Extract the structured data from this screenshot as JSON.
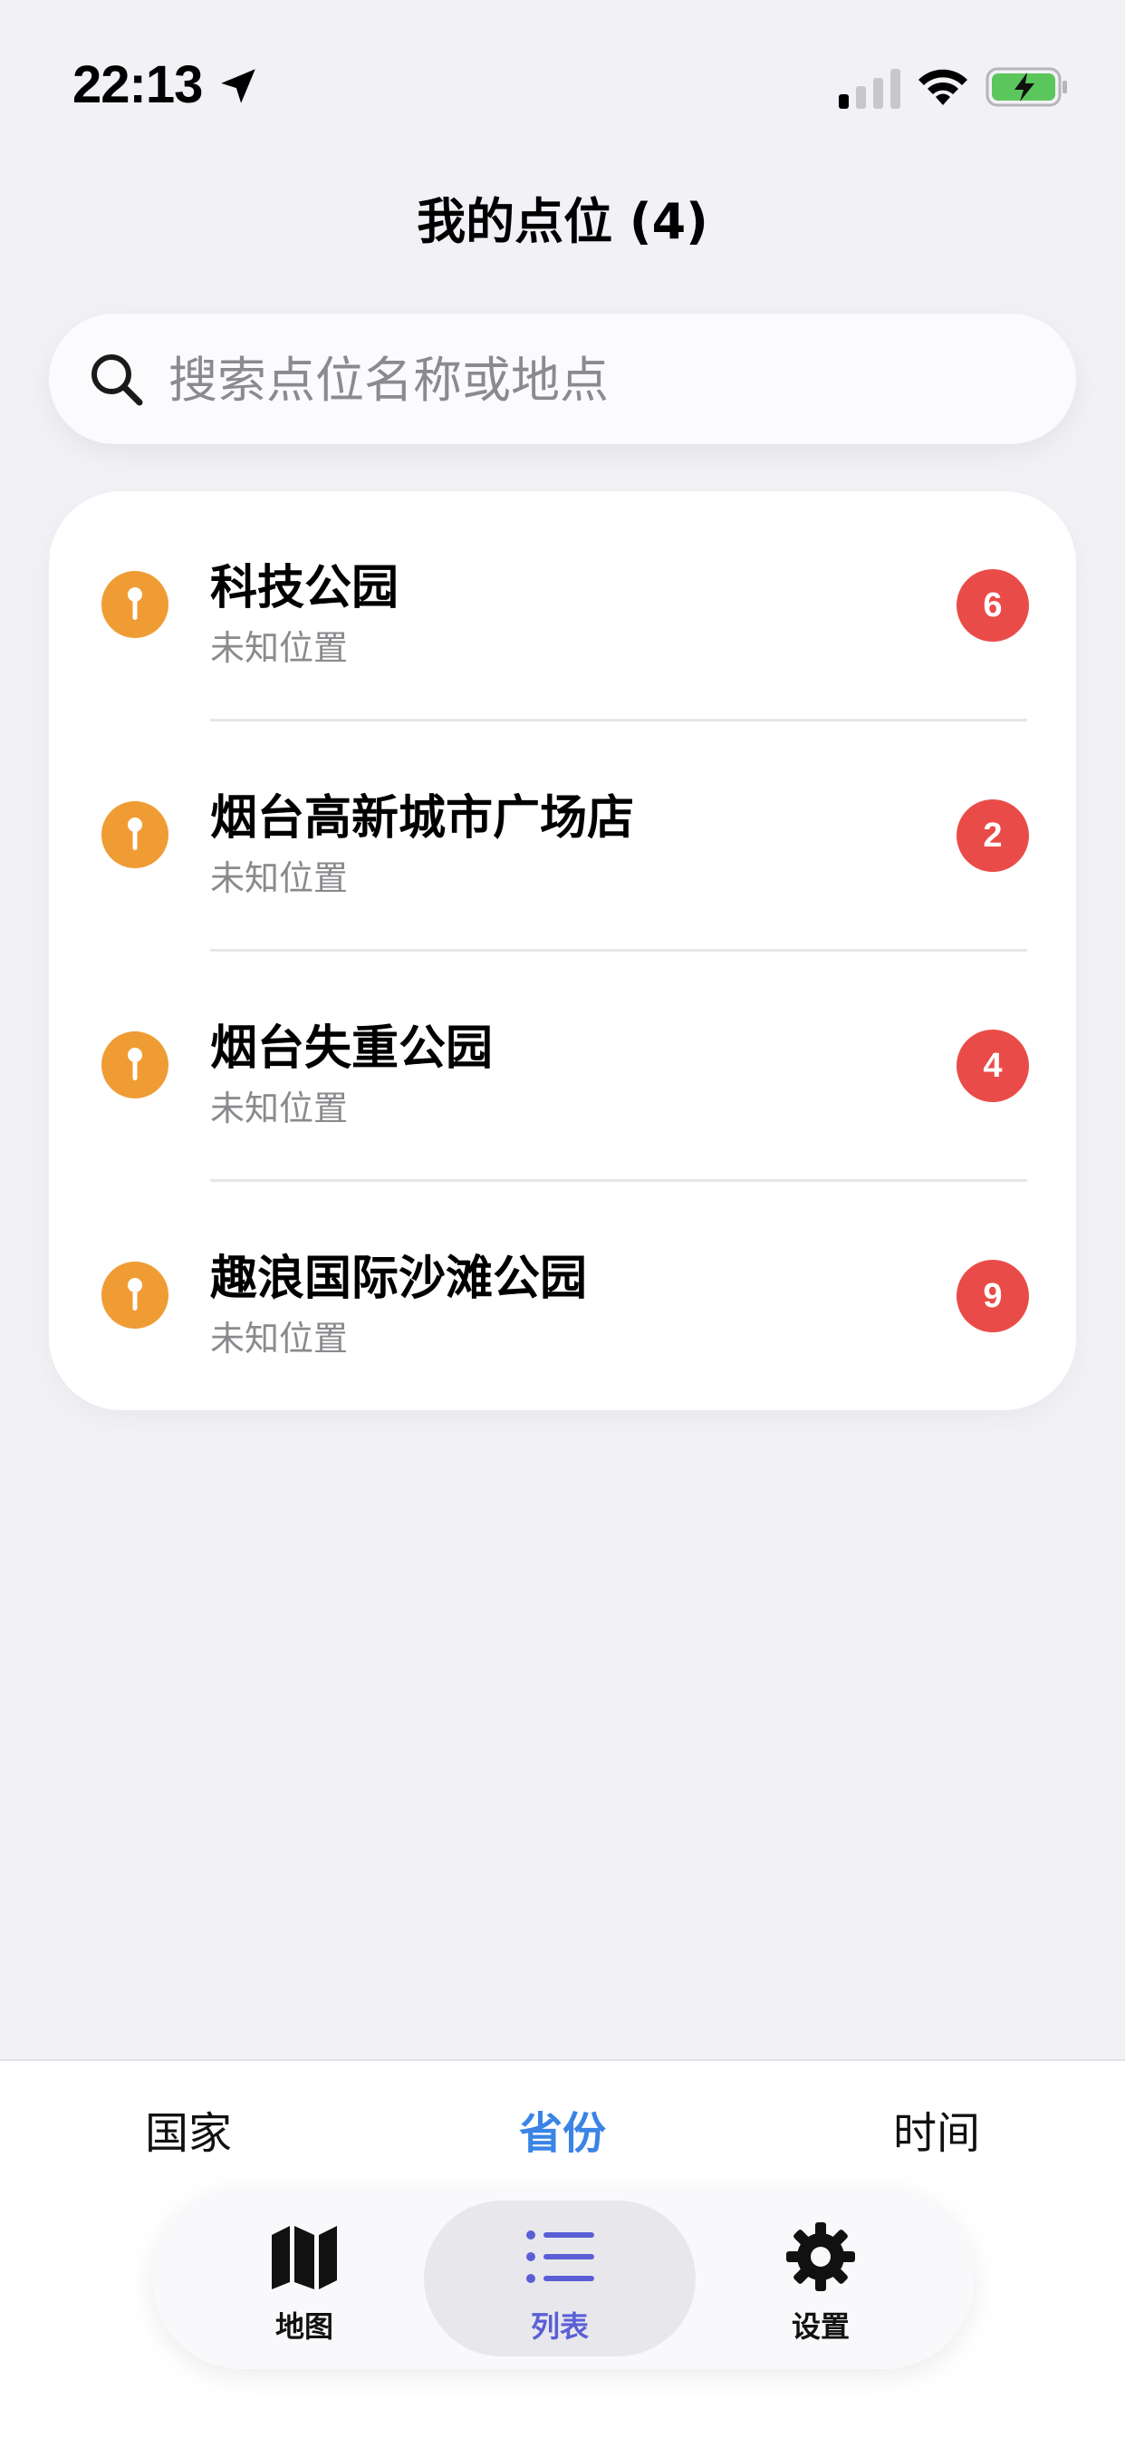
{
  "status_bar": {
    "time": "22:13",
    "location_icon": "location-arrow-icon",
    "signal_icon": "cellular-signal-icon",
    "wifi_icon": "wifi-icon",
    "battery_icon": "battery-charging-icon"
  },
  "header": {
    "title": "我的点位 (4)"
  },
  "search": {
    "placeholder": "搜索点位名称或地点",
    "value": ""
  },
  "list": {
    "items": [
      {
        "name": "科技公园",
        "subtitle": "未知位置",
        "count": "6"
      },
      {
        "name": "烟台高新城市广场店",
        "subtitle": "未知位置",
        "count": "2"
      },
      {
        "name": "烟台失重公园",
        "subtitle": "未知位置",
        "count": "4"
      },
      {
        "name": "趣浪国际沙滩公园",
        "subtitle": "未知位置",
        "count": "9"
      }
    ]
  },
  "segments": {
    "items": [
      {
        "label": "国家",
        "active": false
      },
      {
        "label": "省份",
        "active": true
      },
      {
        "label": "时间",
        "active": false
      }
    ]
  },
  "tab_bar": {
    "items": [
      {
        "label": "地图",
        "icon": "map-icon",
        "active": false
      },
      {
        "label": "列表",
        "icon": "list-icon",
        "active": true
      },
      {
        "label": "设置",
        "icon": "gear-icon",
        "active": false
      }
    ]
  },
  "colors": {
    "background": "#f1f1f6",
    "pin": "#f09c35",
    "badge": "#e94c48",
    "segment_active": "#3a84e6",
    "tab_active": "#5a5fd6",
    "battery": "#5bc65b"
  }
}
